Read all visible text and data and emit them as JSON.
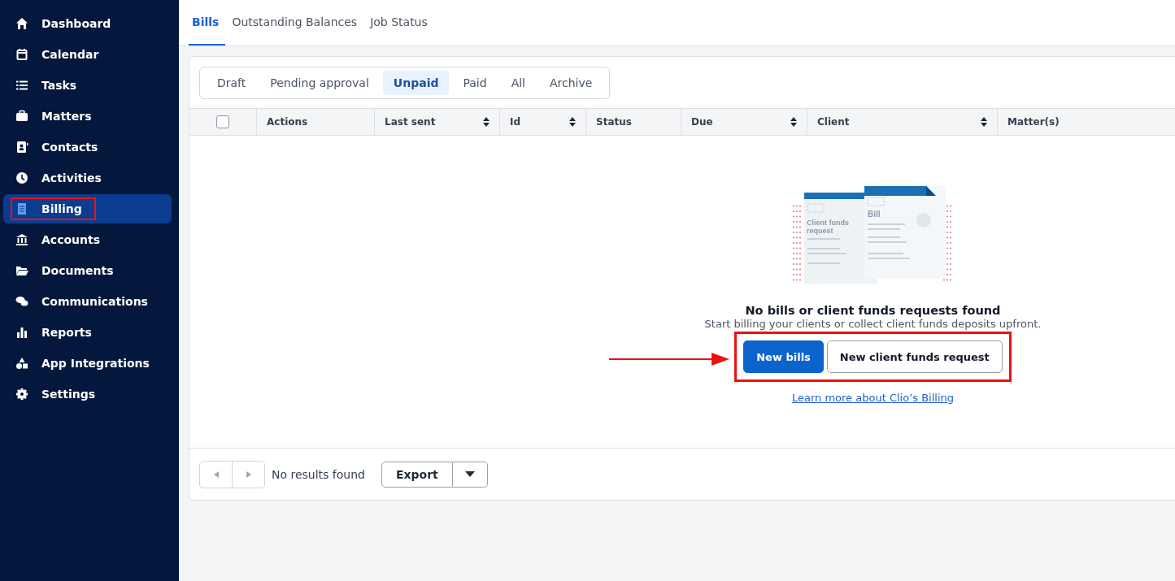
{
  "sidebar": {
    "items": [
      {
        "label": "Dashboard",
        "selected": false,
        "highlighted": false
      },
      {
        "label": "Calendar",
        "selected": false,
        "highlighted": false
      },
      {
        "label": "Tasks",
        "selected": false,
        "highlighted": false
      },
      {
        "label": "Matters",
        "selected": false,
        "highlighted": false
      },
      {
        "label": "Contacts",
        "selected": false,
        "highlighted": false
      },
      {
        "label": "Activities",
        "selected": false,
        "highlighted": false
      },
      {
        "label": "Billing",
        "selected": true,
        "highlighted": true
      },
      {
        "label": "Accounts",
        "selected": false,
        "highlighted": false
      },
      {
        "label": "Documents",
        "selected": false,
        "highlighted": false
      },
      {
        "label": "Communications",
        "selected": false,
        "highlighted": false
      },
      {
        "label": "Reports",
        "selected": false,
        "highlighted": false
      },
      {
        "label": "App Integrations",
        "selected": false,
        "highlighted": false
      },
      {
        "label": "Settings",
        "selected": false,
        "highlighted": false
      }
    ]
  },
  "tabs": [
    {
      "label": "Bills",
      "selected": true
    },
    {
      "label": "Outstanding Balances",
      "selected": false
    },
    {
      "label": "Job Status",
      "selected": false
    }
  ],
  "filters": [
    {
      "label": "Draft",
      "selected": false
    },
    {
      "label": "Pending approval",
      "selected": false
    },
    {
      "label": "Unpaid",
      "selected": true
    },
    {
      "label": "Paid",
      "selected": false
    },
    {
      "label": "All",
      "selected": false
    },
    {
      "label": "Archive",
      "selected": false
    }
  ],
  "table": {
    "select_all": {
      "checked": false
    },
    "columns": [
      {
        "label": "Actions",
        "sortable": false
      },
      {
        "label": "Last sent",
        "sortable": true
      },
      {
        "label": "Id",
        "sortable": true
      },
      {
        "label": "Status",
        "sortable": false
      },
      {
        "label": "Due",
        "sortable": true
      },
      {
        "label": "Client",
        "sortable": true
      },
      {
        "label": "Matter(s)"
      }
    ]
  },
  "empty_state": {
    "illustration": {
      "back_label": "Client funds request",
      "front_label": "Bill"
    },
    "title": "No bills or client funds requests found",
    "message": "Start billing your clients or collect client funds deposits upfront.",
    "highlighted": true,
    "buttons": [
      {
        "label": "New bills",
        "kind": "primary"
      },
      {
        "label": "New client funds request",
        "kind": "secondary"
      }
    ],
    "link": "Learn more about Clio’s Billing"
  },
  "footer": {
    "status": "No results found",
    "export": "Export"
  }
}
